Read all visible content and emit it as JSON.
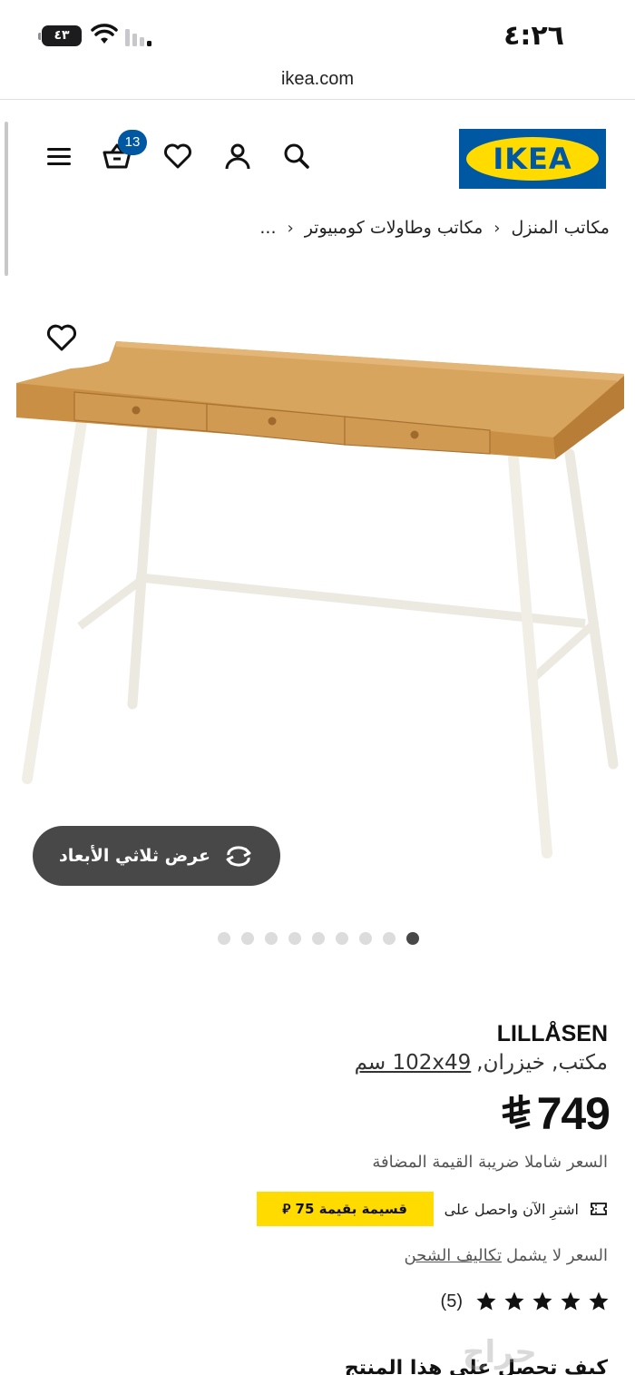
{
  "status_bar": {
    "time": "٤:٢٦",
    "battery": "٤٣"
  },
  "browser": {
    "url": "ikea.com"
  },
  "header": {
    "logo_text": "IKEA",
    "cart_count": "13",
    "brand_blue": "#0058a3",
    "brand_yellow": "#ffdb00"
  },
  "breadcrumb": {
    "ellipsis": "...",
    "items": [
      "مكاتب وطاولات كومبيوتر",
      "مكاتب المنزل"
    ]
  },
  "gallery": {
    "view_3d_label": "عرض ثلاثي الأبعاد",
    "dot_count": 9,
    "active_dot_index": 8
  },
  "product": {
    "name": "LILLÅSEN",
    "description": "مكتب, خيزران,",
    "dimensions": "102x49 سم",
    "price": "749",
    "vat_note": "السعر شاملا ضريبة القيمة المضافة",
    "coupon_text": "اشترِ الآن واحصل على",
    "coupon_badge": "قسيمة بقيمة 75 ⃁",
    "shipping_text": "السعر لا يشمل",
    "shipping_link": "تكاليف الشحن",
    "rating": 5,
    "rating_count": "(5)",
    "next_heading": "كيف تحصل على هذا المنتج"
  },
  "watermark": "حراج"
}
